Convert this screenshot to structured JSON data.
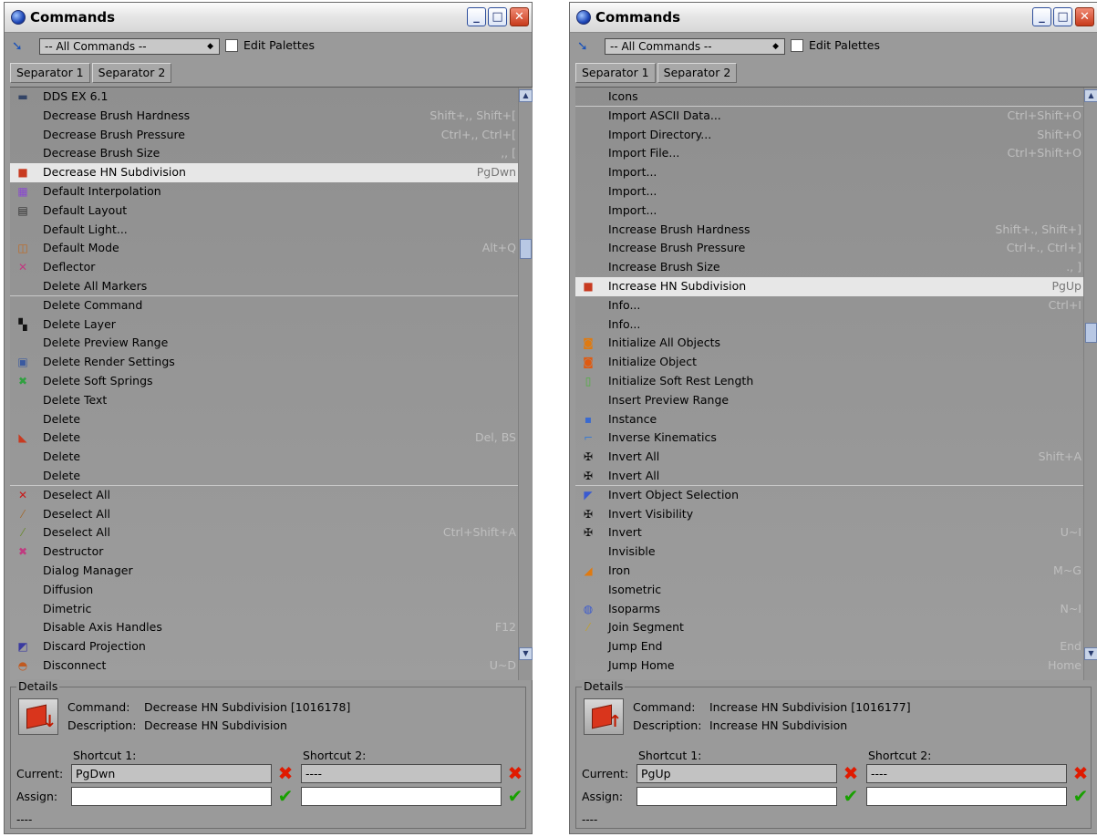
{
  "windows": [
    {
      "title": "Commands",
      "filter": "-- All Commands --",
      "edit_palettes_label": "Edit Palettes",
      "tabs": [
        "Separator 1",
        "Separator 2"
      ],
      "scroll_fraction": 0.26,
      "items": [
        {
          "label": "DDS EX 6.1",
          "icon": "dds-ex-icon",
          "glyph": "▬",
          "color": "#334466"
        },
        {
          "label": "Decrease Brush Hardness",
          "shortcut": "Shift+,, Shift+["
        },
        {
          "label": "Decrease Brush Pressure",
          "shortcut": "Ctrl+,, Ctrl+["
        },
        {
          "label": "Decrease Brush Size",
          "shortcut": ",, ["
        },
        {
          "label": "Decrease HN Subdivision",
          "shortcut": "PgDwn",
          "icon": "hn-subdivision-down-icon",
          "glyph": "■",
          "color": "#c83a20",
          "selected": true
        },
        {
          "label": "Default Interpolation",
          "icon": "interpolation-icon",
          "glyph": "▦",
          "color": "#8a4ad0"
        },
        {
          "label": "Default Layout",
          "icon": "layout-icon",
          "glyph": "▤",
          "color": "#333333"
        },
        {
          "label": "Default Light..."
        },
        {
          "label": "Default Mode",
          "shortcut": "Alt+Q",
          "icon": "default-mode-icon",
          "glyph": "◫",
          "color": "#c06a20"
        },
        {
          "label": "Deflector",
          "icon": "deflector-icon",
          "glyph": "✕",
          "color": "#c03a80"
        },
        {
          "label": "Delete All Markers",
          "sep": true
        },
        {
          "label": "Delete Command"
        },
        {
          "label": "Delete Layer",
          "icon": "delete-layer-icon",
          "glyph": "▚",
          "color": "#111111"
        },
        {
          "label": "Delete Preview Range"
        },
        {
          "label": "Delete Render Settings",
          "icon": "delete-render-settings-icon",
          "glyph": "▣",
          "color": "#3a5aa0"
        },
        {
          "label": "Delete Soft Springs",
          "icon": "delete-soft-springs-icon",
          "glyph": "✖",
          "color": "#30a040"
        },
        {
          "label": "Delete Text"
        },
        {
          "label": "Delete"
        },
        {
          "label": "Delete",
          "shortcut": "Del, BS",
          "icon": "delete-icon",
          "glyph": "◣",
          "color": "#c83a20"
        },
        {
          "label": "Delete"
        },
        {
          "label": "Delete",
          "sep": true
        },
        {
          "label": "Deselect All",
          "icon": "deselect-all-icon",
          "glyph": "✕",
          "color": "#c81a1a"
        },
        {
          "label": "Deselect All",
          "icon": "deselect-all-brush-icon",
          "glyph": "⁄",
          "color": "#a06a30"
        },
        {
          "label": "Deselect All",
          "shortcut": "Ctrl+Shift+A",
          "icon": "deselect-all-polygon-icon",
          "glyph": "⁄",
          "color": "#6a8a30"
        },
        {
          "label": "Destructor",
          "icon": "destructor-icon",
          "glyph": "✖",
          "color": "#c03a80"
        },
        {
          "label": "Dialog Manager"
        },
        {
          "label": "Diffusion"
        },
        {
          "label": "Dimetric"
        },
        {
          "label": "Disable Axis Handles",
          "shortcut": "F12"
        },
        {
          "label": "Discard Projection",
          "icon": "discard-projection-icon",
          "glyph": "◩",
          "color": "#3a3aa0"
        },
        {
          "label": "Disconnect",
          "shortcut": "U~D",
          "icon": "disconnect-icon",
          "glyph": "◓",
          "color": "#c05a20"
        }
      ],
      "details": {
        "title": "Details",
        "command_label": "Command:",
        "command_value": "Decrease HN Subdivision [1016178]",
        "description_label": "Description:",
        "description_value": "Decrease HN Subdivision",
        "arrow": "↓",
        "shortcut1_label": "Shortcut 1:",
        "shortcut2_label": "Shortcut 2:",
        "current_label": "Current:",
        "assign_label": "Assign:",
        "current1": "PgDwn",
        "current2": "----",
        "assign1": "",
        "assign2": "",
        "status": "----"
      }
    },
    {
      "title": "Commands",
      "filter": "-- All Commands --",
      "edit_palettes_label": "Edit Palettes",
      "tabs": [
        "Separator 1",
        "Separator 2"
      ],
      "scroll_fraction": 0.42,
      "items": [
        {
          "label": "Icons",
          "sep": true
        },
        {
          "label": "Import ASCII Data...",
          "shortcut": "Ctrl+Shift+O"
        },
        {
          "label": "Import Directory...",
          "shortcut": "Shift+O"
        },
        {
          "label": "Import File...",
          "shortcut": "Ctrl+Shift+O"
        },
        {
          "label": "Import..."
        },
        {
          "label": "Import..."
        },
        {
          "label": "Import..."
        },
        {
          "label": "Increase Brush Hardness",
          "shortcut": "Shift+., Shift+]"
        },
        {
          "label": "Increase Brush Pressure",
          "shortcut": "Ctrl+., Ctrl+]"
        },
        {
          "label": "Increase Brush Size",
          "shortcut": "., ]"
        },
        {
          "label": "Increase HN Subdivision",
          "shortcut": "PgUp",
          "icon": "hn-subdivision-up-icon",
          "glyph": "■",
          "color": "#c83a20",
          "selected": true
        },
        {
          "label": "Info...",
          "shortcut": "Ctrl+I"
        },
        {
          "label": "Info..."
        },
        {
          "label": "Initialize All Objects",
          "icon": "initialize-all-objects-icon",
          "glyph": "◙",
          "color": "#e07a10"
        },
        {
          "label": "Initialize Object",
          "icon": "initialize-object-icon",
          "glyph": "◙",
          "color": "#e05a10"
        },
        {
          "label": "Initialize Soft Rest Length",
          "icon": "initialize-soft-rest-length-icon",
          "glyph": "▯",
          "color": "#50b040"
        },
        {
          "label": "Insert Preview Range"
        },
        {
          "label": "Instance",
          "icon": "instance-icon",
          "glyph": "▪",
          "color": "#3a6ad0"
        },
        {
          "label": "Inverse Kinematics",
          "icon": "inverse-kinematics-icon",
          "glyph": "⌐",
          "color": "#3a7ad0"
        },
        {
          "label": "Invert All",
          "shortcut": "Shift+A",
          "icon": "invert-all-icon",
          "glyph": "✠",
          "color": "#111111"
        },
        {
          "label": "Invert All",
          "icon": "invert-all-alt-icon",
          "glyph": "✠",
          "color": "#111111",
          "sep": true
        },
        {
          "label": "Invert Object Selection",
          "icon": "invert-object-selection-icon",
          "glyph": "◤",
          "color": "#3a5ad0"
        },
        {
          "label": "Invert Visibility",
          "icon": "invert-visibility-icon",
          "glyph": "✠",
          "color": "#111111"
        },
        {
          "label": "Invert",
          "shortcut": "U~I",
          "icon": "invert-icon",
          "glyph": "✠",
          "color": "#111111"
        },
        {
          "label": "Invisible"
        },
        {
          "label": "Iron",
          "shortcut": "M~G",
          "icon": "iron-icon",
          "glyph": "◢",
          "color": "#e07a10"
        },
        {
          "label": "Isometric"
        },
        {
          "label": "Isoparms",
          "shortcut": "N~I",
          "icon": "isoparms-icon",
          "glyph": "◍",
          "color": "#3a5ad0"
        },
        {
          "label": "Join Segment",
          "icon": "join-segment-icon",
          "glyph": "⁄",
          "color": "#c0a030"
        },
        {
          "label": "Jump End",
          "shortcut": "End"
        },
        {
          "label": "Jump Home",
          "shortcut": "Home"
        }
      ],
      "details": {
        "title": "Details",
        "command_label": "Command:",
        "command_value": "Increase HN Subdivision [1016177]",
        "description_label": "Description:",
        "description_value": "Increase HN Subdivision",
        "arrow": "↑",
        "shortcut1_label": "Shortcut 1:",
        "shortcut2_label": "Shortcut 2:",
        "current_label": "Current:",
        "assign_label": "Assign:",
        "current1": "PgUp",
        "current2": "----",
        "assign1": "",
        "assign2": "",
        "status": "----"
      }
    }
  ]
}
